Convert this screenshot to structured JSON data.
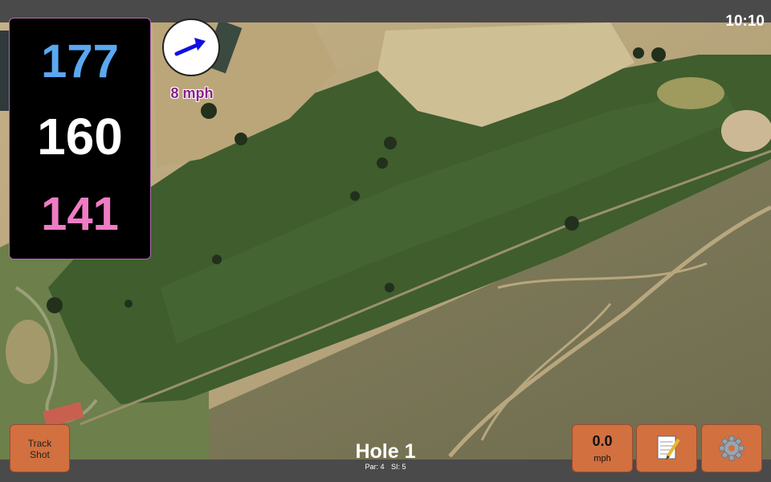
{
  "status_bar": {
    "time": "10:10"
  },
  "distances": {
    "back": "177",
    "middle": "160",
    "front": "141",
    "back_color": "#5aa8f0",
    "middle_color": "#ffffff",
    "front_color": "#f07cc4"
  },
  "wind": {
    "speed": "8 mph",
    "arrow_icon": "arrow-icon",
    "arrow_color": "#1010e0",
    "speed_color": "#8a1f8a"
  },
  "hole": {
    "title": "Hole 1",
    "par": "Par: 4",
    "si": "SI: 5"
  },
  "buttons": {
    "track_shot_line1": "Track",
    "track_shot_line2": "Shot",
    "speed_value": "0.0",
    "speed_unit": "mph",
    "notes_icon": "notepad-icon",
    "settings_icon": "gear-icon",
    "color": "#d2703f"
  },
  "map": {
    "fairway_color": "#3e5c2c",
    "rough_color": "#7c7a57",
    "sand_color": "#c9b78a"
  }
}
